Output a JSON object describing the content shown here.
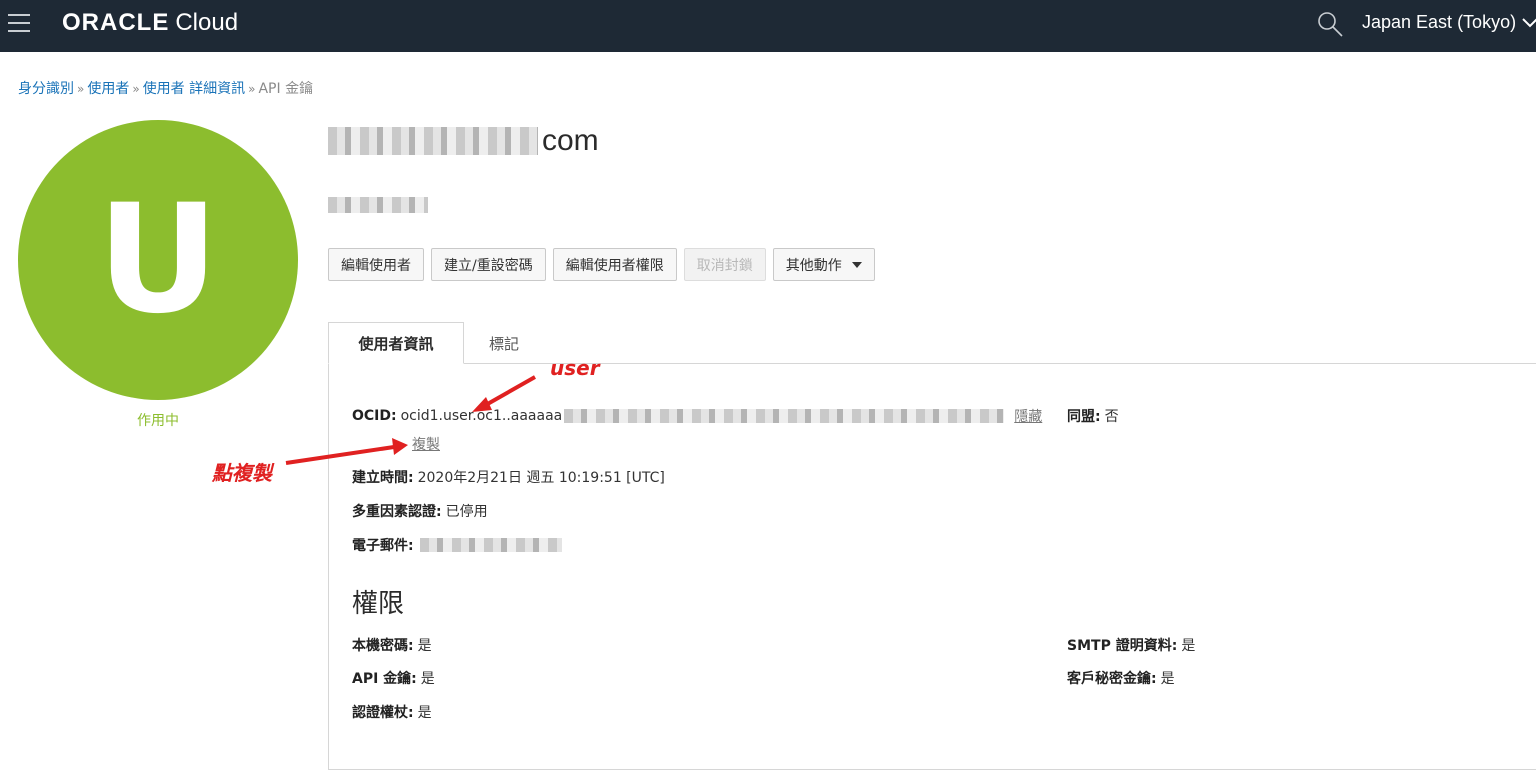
{
  "topbar": {
    "brand": "ORACLE",
    "product": "Cloud",
    "region": "Japan East (Tokyo)",
    "icons": [
      "menu-icon",
      "search-icon",
      "chevron-down-icon"
    ]
  },
  "breadcrumb": {
    "items": [
      "身分識別",
      "使用者",
      "使用者 詳細資訊"
    ],
    "separator": "»",
    "current": "API 金鑰"
  },
  "profile": {
    "avatar_letter": "U",
    "avatar_color": "#8cbd2e",
    "status": "作用中",
    "title_suffix": "com"
  },
  "actions": {
    "edit_user": "編輯使用者",
    "reset_password": "建立/重設密碼",
    "edit_capabilities": "編輯使用者權限",
    "unblock": "取消封鎖",
    "more_actions": "其他動作"
  },
  "tabs": {
    "user_info": "使用者資訊",
    "tags": "標記"
  },
  "info": {
    "ocid_label": "OCID:",
    "ocid_value": "ocid1.user.oc1..aaaaaa",
    "hide_link": "隱藏",
    "copy_link": "複製",
    "federated_label": "同盟:",
    "federated_value": "否",
    "created_label": "建立時間:",
    "created_value": "2020年2月21日 週五 10:19:51 [UTC]",
    "mfa_label": "多重因素認證:",
    "mfa_value": "已停用",
    "email_label": "電子郵件:"
  },
  "capabilities": {
    "title": "權限",
    "local_password_label": "本機密碼:",
    "local_password_value": "是",
    "api_keys_label": "API 金鑰:",
    "api_keys_value": "是",
    "auth_tokens_label": "認證權杖:",
    "auth_tokens_value": "是",
    "smtp_label": "SMTP 證明資料:",
    "smtp_value": "是",
    "customer_secret_label": "客戶秘密金鑰:",
    "customer_secret_value": "是"
  },
  "annotations": {
    "user_note": "user",
    "copy_note": "點複製",
    "color": "#e02121"
  }
}
